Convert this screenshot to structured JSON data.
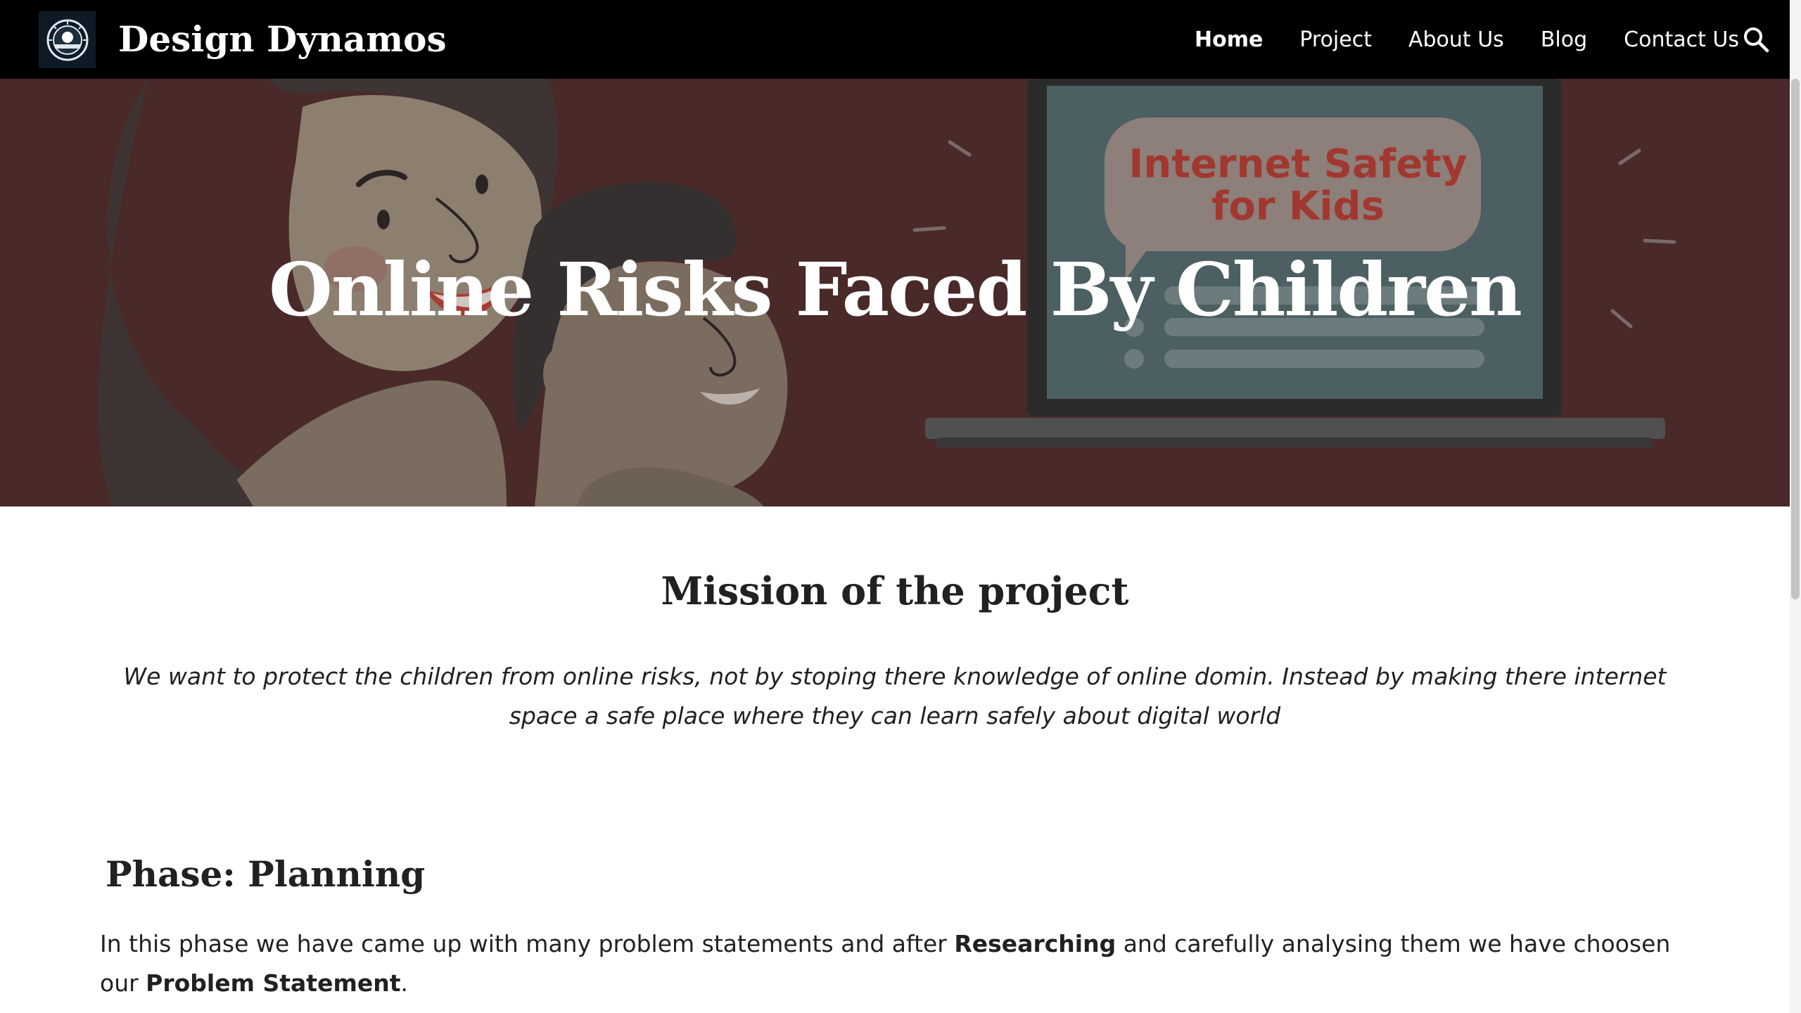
{
  "header": {
    "site_title": "Design Dynamos",
    "nav": [
      {
        "label": "Home",
        "active": true
      },
      {
        "label": "Project",
        "active": false
      },
      {
        "label": "About Us",
        "active": false
      },
      {
        "label": "Blog",
        "active": false
      },
      {
        "label": "Contact Us",
        "active": false
      }
    ],
    "logo_icon": "design-dynamos-badge",
    "search_icon": "search-icon"
  },
  "hero": {
    "title": "Online Risks Faced By Children",
    "image_text_line1": "Internet Safety",
    "image_text_line2": "for Kids",
    "overlay_color": "#4a2929"
  },
  "mission": {
    "title": "Mission of the project",
    "text": "We want to protect the children from online risks, not by stoping there knowledge of online domin. Instead by making there internet space a safe place where they can learn safely about digital world"
  },
  "phase": {
    "title": "Phase: Planning",
    "text_part1": "In this phase we have came up with many problem statements and after ",
    "bold1": "Researching",
    "text_part2": " and carefully analysing them we have choosen our ",
    "bold2": "Problem Statement",
    "text_part3": "."
  },
  "colors": {
    "header_bg": "#000000",
    "text": "#212121"
  }
}
